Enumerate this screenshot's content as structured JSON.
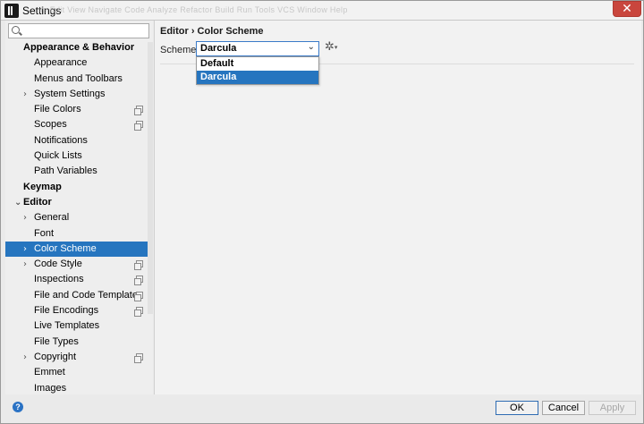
{
  "window": {
    "title": "Settings",
    "close_glyph": "✕",
    "bg_menu": "ile  Edit  View  Navigate  Code  Analyze  Refactor  Build  Run  Tools  VCS  Window  Help"
  },
  "search": {
    "placeholder": "",
    "value": ""
  },
  "tree": [
    {
      "label": "Appearance & Behavior",
      "indent": 0,
      "bold": true,
      "chevron": "",
      "copy": false
    },
    {
      "label": "Appearance",
      "indent": 2,
      "bold": false,
      "chevron": "",
      "copy": false
    },
    {
      "label": "Menus and Toolbars",
      "indent": 2,
      "bold": false,
      "chevron": "",
      "copy": false
    },
    {
      "label": "System Settings",
      "indent": 1,
      "bold": false,
      "chevron": "›",
      "copy": false
    },
    {
      "label": "File Colors",
      "indent": 2,
      "bold": false,
      "chevron": "",
      "copy": true
    },
    {
      "label": "Scopes",
      "indent": 2,
      "bold": false,
      "chevron": "",
      "copy": true
    },
    {
      "label": "Notifications",
      "indent": 2,
      "bold": false,
      "chevron": "",
      "copy": false
    },
    {
      "label": "Quick Lists",
      "indent": 2,
      "bold": false,
      "chevron": "",
      "copy": false
    },
    {
      "label": "Path Variables",
      "indent": 2,
      "bold": false,
      "chevron": "",
      "copy": false
    },
    {
      "label": "Keymap",
      "indent": 0,
      "bold": true,
      "chevron": "",
      "copy": false
    },
    {
      "label": "Editor",
      "indent": 0,
      "bold": true,
      "chevron": "⌄",
      "copy": false
    },
    {
      "label": "General",
      "indent": 1,
      "bold": false,
      "chevron": "›",
      "copy": false
    },
    {
      "label": "Font",
      "indent": 2,
      "bold": false,
      "chevron": "",
      "copy": false
    },
    {
      "label": "Color Scheme",
      "indent": 1,
      "bold": false,
      "chevron": "›",
      "copy": false,
      "selected": true
    },
    {
      "label": "Code Style",
      "indent": 1,
      "bold": false,
      "chevron": "›",
      "copy": true
    },
    {
      "label": "Inspections",
      "indent": 2,
      "bold": false,
      "chevron": "",
      "copy": true
    },
    {
      "label": "File and Code Templates",
      "indent": 2,
      "bold": false,
      "chevron": "",
      "copy": true
    },
    {
      "label": "File Encodings",
      "indent": 2,
      "bold": false,
      "chevron": "",
      "copy": true
    },
    {
      "label": "Live Templates",
      "indent": 2,
      "bold": false,
      "chevron": "",
      "copy": false
    },
    {
      "label": "File Types",
      "indent": 2,
      "bold": false,
      "chevron": "",
      "copy": false
    },
    {
      "label": "Copyright",
      "indent": 1,
      "bold": false,
      "chevron": "›",
      "copy": true
    },
    {
      "label": "Emmet",
      "indent": 2,
      "bold": false,
      "chevron": "",
      "copy": false
    },
    {
      "label": "Images",
      "indent": 2,
      "bold": false,
      "chevron": "",
      "copy": false
    }
  ],
  "content": {
    "breadcrumb": "Editor › Color Scheme",
    "scheme_label": "Scheme:",
    "scheme_value": "Darcula",
    "chevron": "⌄",
    "gear_glyph": "✲",
    "gear_arrow": "▾",
    "dropdown_options": [
      {
        "label": "Default",
        "selected": false
      },
      {
        "label": "Darcula",
        "selected": true
      }
    ]
  },
  "footer": {
    "help": "?",
    "ok": "OK",
    "cancel": "Cancel",
    "apply": "Apply"
  }
}
